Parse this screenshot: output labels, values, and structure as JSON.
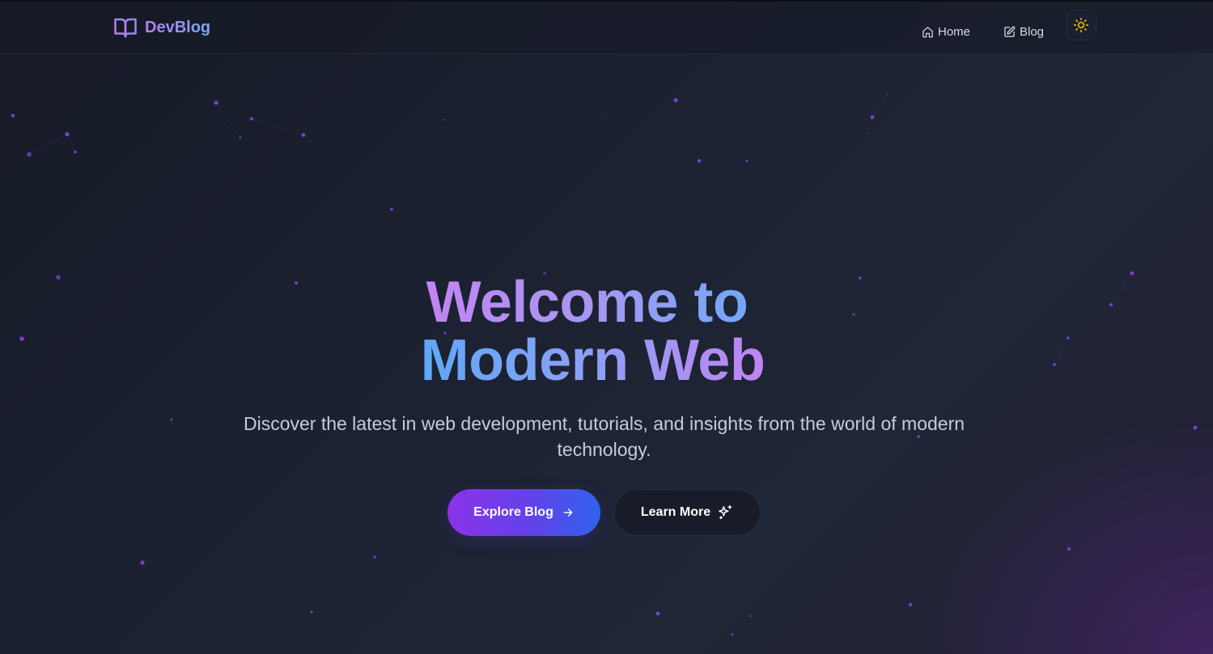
{
  "brand": {
    "name": "DevBlog",
    "icon": "book-open-icon"
  },
  "nav": {
    "items": [
      {
        "label": "Home",
        "icon": "home-icon"
      },
      {
        "label": "Blog",
        "icon": "edit-icon"
      }
    ],
    "theme_toggle_icon": "sun-icon"
  },
  "hero": {
    "title_line1": "Welcome to",
    "title_line2": "Modern Web",
    "subtitle": "Discover the latest in web development, tutorials, and insights from the world of modern technology.",
    "primary_button": {
      "label": "Explore Blog",
      "icon": "arrow-right-icon"
    },
    "secondary_button": {
      "label": "Learn More",
      "icon": "sparkles-icon"
    }
  },
  "colors": {
    "background": "#1a1f2e",
    "accent_purple": "#8b33e8",
    "accent_blue": "#2f63ec",
    "sun": "#f5b400",
    "particle": "#7b3fd1"
  }
}
